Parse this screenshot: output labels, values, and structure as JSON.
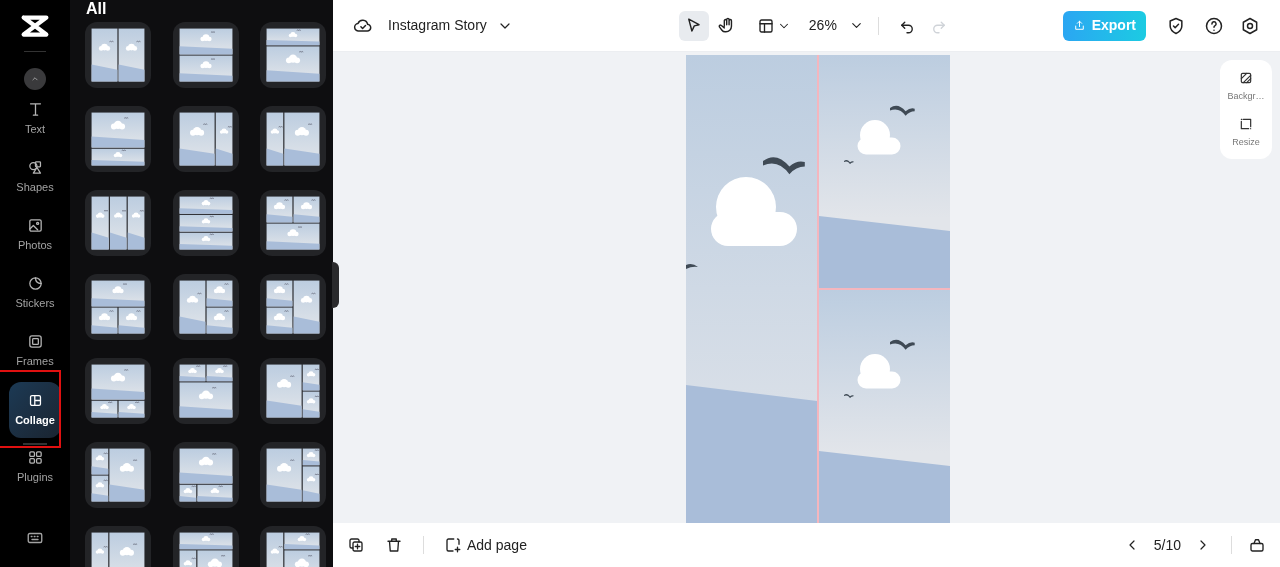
{
  "rail": {
    "items": [
      {
        "kind": "text",
        "label": "Text",
        "selected": false
      },
      {
        "kind": "shapes",
        "label": "Shapes",
        "selected": false
      },
      {
        "kind": "photos",
        "label": "Photos",
        "selected": false
      },
      {
        "kind": "stickers",
        "label": "Stickers",
        "selected": false
      },
      {
        "kind": "frames",
        "label": "Frames",
        "selected": false
      },
      {
        "kind": "collage",
        "label": "Collage",
        "selected": true
      },
      {
        "kind": "plugins",
        "label": "Plugins",
        "selected": false
      }
    ]
  },
  "panel": {
    "heading": "All",
    "templates": [
      {
        "kind": "cols2"
      },
      {
        "kind": "rows2"
      },
      {
        "kind": "top-strip"
      },
      {
        "kind": "bottom-strip"
      },
      {
        "kind": "cols-wide-left"
      },
      {
        "kind": "cols-wide-right"
      },
      {
        "kind": "cols3"
      },
      {
        "kind": "rows3"
      },
      {
        "kind": "two-top-one-bottom"
      },
      {
        "kind": "one-top-two-bottom"
      },
      {
        "kind": "left-tall-right-two"
      },
      {
        "kind": "left-two-right-tall"
      },
      {
        "kind": "big-top-two-bottom"
      },
      {
        "kind": "two-top-big-bottom"
      },
      {
        "kind": "big-left-two-right"
      },
      {
        "kind": "two-left-big-right"
      },
      {
        "kind": "big-top-uneven-bottom"
      },
      {
        "kind": "big-left-uneven-right"
      },
      {
        "kind": "cols-wide-right"
      },
      {
        "kind": "strip-top-uneven-bottom"
      },
      {
        "kind": "narrow-left-uneven-right"
      }
    ]
  },
  "toolbar": {
    "project_title": "Instagram Story",
    "tools": [
      {
        "kind": "pointer",
        "selected": true
      },
      {
        "kind": "hand",
        "selected": false
      }
    ],
    "zoom": "26%",
    "history": [
      {
        "kind": "undo",
        "disabled": false
      },
      {
        "kind": "redo",
        "disabled": true
      }
    ],
    "export_label": "Export"
  },
  "side_tools": [
    {
      "kind": "background",
      "label": "Backgr…"
    },
    {
      "kind": "resize",
      "label": "Resize"
    }
  ],
  "bottom_bar": {
    "add_page": "Add page",
    "page_counter": "5/10"
  }
}
